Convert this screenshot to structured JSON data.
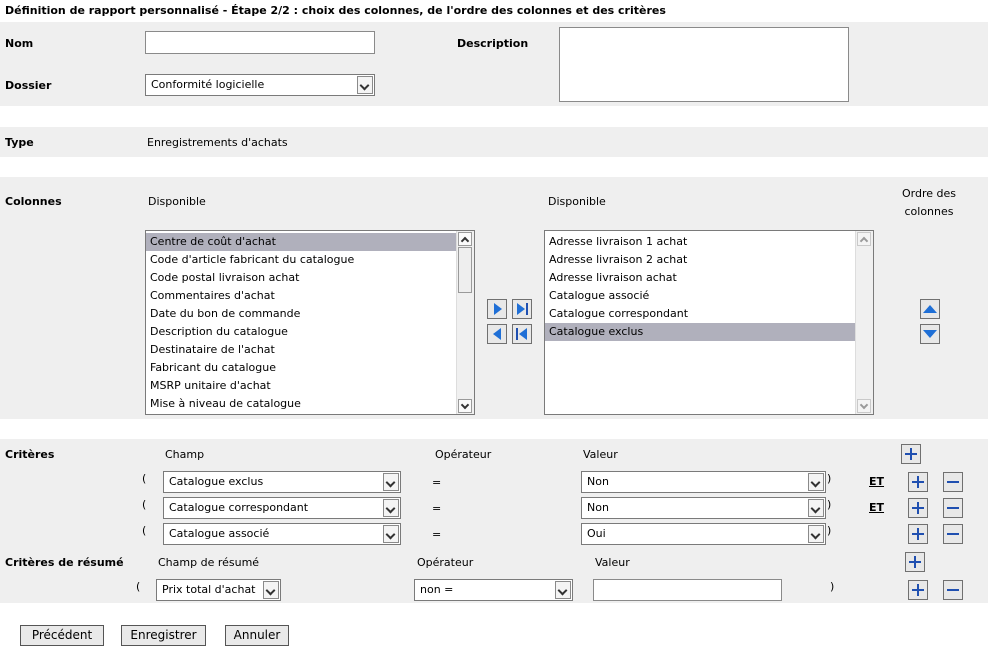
{
  "page": {
    "title": "Définition de rapport personnalisé - Étape 2/2 : choix des colonnes, de l'ordre des colonnes et des critères"
  },
  "header": {
    "nom_label": "Nom",
    "nom_value": "",
    "description_label": "Description",
    "description_value": "",
    "dossier_label": "Dossier",
    "dossier_value": "Conformité logicielle"
  },
  "type": {
    "label": "Type",
    "value": "Enregistrements d'achats"
  },
  "colonnes": {
    "label": "Colonnes",
    "available_header": "Disponible",
    "selected_header": "Disponible",
    "order_header_line1": "Ordre des",
    "order_header_line2": "colonnes",
    "available": [
      "Centre de coût d'achat",
      "Code d'article fabricant du catalogue",
      "Code postal livraison achat",
      "Commentaires d'achat",
      "Date du bon de commande",
      "Description du catalogue",
      "Destinataire de l'achat",
      "Fabricant du catalogue",
      "MSRP unitaire d'achat",
      "Mise à niveau de catalogue"
    ],
    "selected": [
      "Adresse livraison 1 achat",
      "Adresse livraison 2 achat",
      "Adresse livraison achat",
      "Catalogue associé",
      "Catalogue correspondant",
      "Catalogue exclus"
    ]
  },
  "criteres": {
    "label": "Critères",
    "champ_header": "Champ",
    "operateur_header": "Opérateur",
    "valeur_header": "Valeur",
    "rows": [
      {
        "open": "(",
        "champ": "Catalogue exclus",
        "op": "=",
        "valeur": "Non",
        "close": ")",
        "join": "ET"
      },
      {
        "open": "(",
        "champ": "Catalogue correspondant",
        "op": "=",
        "valeur": "Non",
        "close": ")",
        "join": "ET"
      },
      {
        "open": "(",
        "champ": "Catalogue associé",
        "op": "=",
        "valeur": "Oui",
        "close": ")",
        "join": ""
      }
    ]
  },
  "resume": {
    "label": "Critères de résumé",
    "champ_header": "Champ de résumé",
    "operateur_header": "Opérateur",
    "valeur_header": "Valeur",
    "row": {
      "open": "(",
      "champ": "Prix total d'achat",
      "op": "non =",
      "valeur": "",
      "close": ")"
    }
  },
  "buttons": {
    "previous": "Précédent",
    "save": "Enregistrer",
    "cancel": "Annuler"
  },
  "colors": {
    "band": "#efefef",
    "selection": "#b0b0bc",
    "accent_blue": "#1f6fd6"
  }
}
